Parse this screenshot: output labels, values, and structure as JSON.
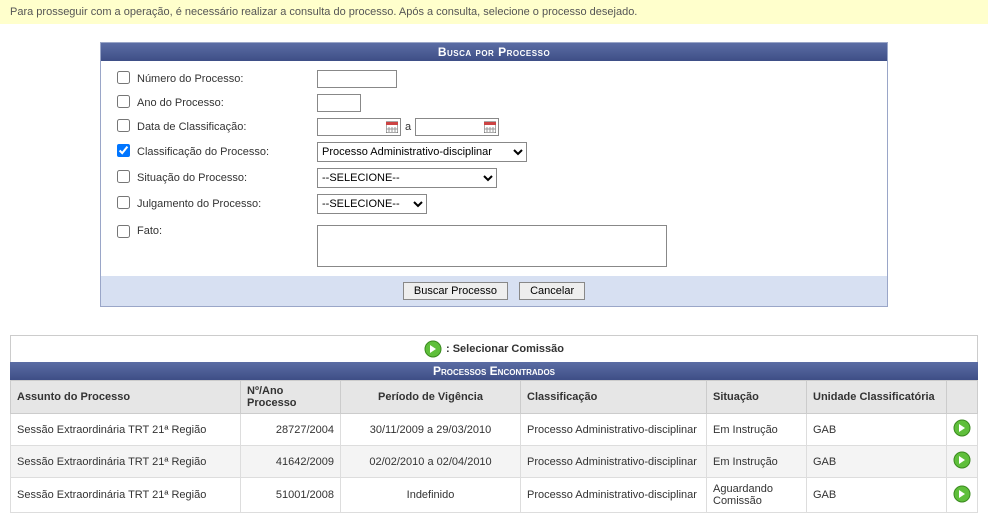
{
  "info_message": "Para prosseguir com a operação, é necessário realizar a consulta do processo. Após a consulta, selecione o processo desejado.",
  "search_panel": {
    "title": "Busca por Processo",
    "fields": {
      "numero": {
        "label": "Número do Processo:",
        "checked": false,
        "value": ""
      },
      "ano": {
        "label": "Ano do Processo:",
        "checked": false,
        "value": ""
      },
      "data_classif": {
        "label": "Data de Classificação:",
        "checked": false,
        "from": "",
        "to": "",
        "separator": "a"
      },
      "classif": {
        "label": "Classificação do Processo:",
        "checked": true,
        "selected": "Processo Administrativo-disciplinar"
      },
      "situacao": {
        "label": "Situação do Processo:",
        "checked": false,
        "selected": "--SELECIONE--"
      },
      "julgamento": {
        "label": "Julgamento do Processo:",
        "checked": false,
        "selected": "--SELECIONE--"
      },
      "fato": {
        "label": "Fato:",
        "checked": false,
        "value": ""
      }
    },
    "buttons": {
      "search": "Buscar Processo",
      "cancel": "Cancelar"
    }
  },
  "legend": ": Selecionar Comissão",
  "results": {
    "title": "Processos Encontrados",
    "headers": {
      "assunto": "Assunto do Processo",
      "numano": "Nº/Ano Processo",
      "periodo": "Período de Vigência",
      "classif": "Classificação",
      "situacao": "Situação",
      "unidade": "Unidade Classificatória"
    },
    "rows": [
      {
        "assunto": "Sessão Extraordinária TRT 21ª Região",
        "numano": "28727/2004",
        "periodo": "30/11/2009  a  29/03/2010",
        "classif": "Processo Administrativo-disciplinar",
        "situacao": "Em Instrução",
        "unidade": "GAB"
      },
      {
        "assunto": "Sessão Extraordinária TRT 21ª Região",
        "numano": "41642/2009",
        "periodo": "02/02/2010  a  02/04/2010",
        "classif": "Processo Administrativo-disciplinar",
        "situacao": "Em Instrução",
        "unidade": "GAB"
      },
      {
        "assunto": "Sessão Extraordinária TRT 21ª Região",
        "numano": "51001/2008",
        "periodo": "Indefinido",
        "classif": "Processo Administrativo-disciplinar",
        "situacao": "Aguardando Comissão",
        "unidade": "GAB"
      }
    ]
  }
}
